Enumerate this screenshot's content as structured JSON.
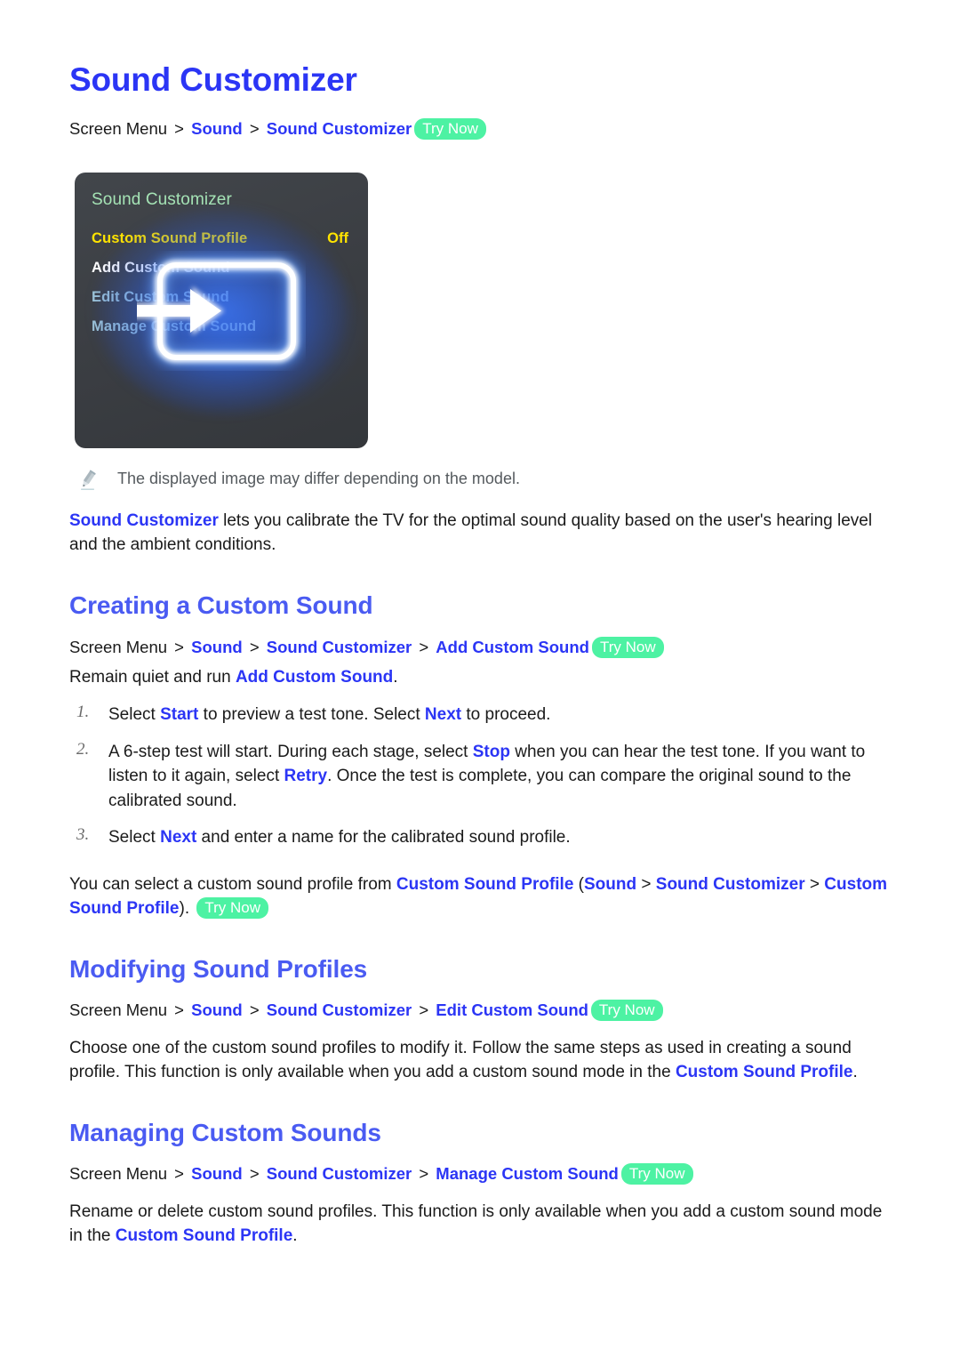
{
  "document": {
    "title": "Sound Customizer"
  },
  "intro": {
    "breadcrumb": {
      "root": "Screen Menu",
      "sep": ">",
      "parts": [
        "Sound",
        "Sound Customizer"
      ],
      "try_now": "Try Now"
    },
    "note_icon": "pencil-icon",
    "note": "The displayed image may differ depending on the model.",
    "paragraph": {
      "link": "Sound Customizer",
      "rest": " lets you calibrate the TV for the optimal sound quality based on the user's hearing level and the ambient conditions."
    }
  },
  "tv_mock": {
    "title": "Sound Customizer",
    "rows": [
      {
        "label": "Custom Sound Profile",
        "value": "Off",
        "state": "highlighted"
      },
      {
        "label": "Add Custom Sound",
        "value": "",
        "state": "active"
      },
      {
        "label": "Edit Custom Sound",
        "value": "",
        "state": "dimmed"
      },
      {
        "label": "Manage Custom Sound",
        "value": "",
        "state": "dimmed"
      }
    ],
    "overlay_icon": "tv-arrow-glow-icon",
    "colors": {
      "panel_bg": "#3b3e43",
      "title": "#a5e3b5",
      "highlight": "#ffe400",
      "active": "#ffffff",
      "dimmed": "#9fc6d8",
      "glow": "#3c78ff"
    }
  },
  "sections": [
    {
      "heading": "Creating a Custom Sound",
      "breadcrumb": {
        "root": "Screen Menu",
        "sep": ">",
        "parts": [
          "Sound",
          "Sound Customizer",
          "Add Custom Sound"
        ],
        "try_now": "Try Now"
      },
      "lead_pre": "Remain quiet and run ",
      "lead_link": "Add Custom Sound",
      "lead_post": ".",
      "steps": [
        {
          "num": "1.",
          "segments": [
            {
              "t": "Select ",
              "s": "plain"
            },
            {
              "t": "Start",
              "s": "blue"
            },
            {
              "t": " to preview a test tone. Select ",
              "s": "plain"
            },
            {
              "t": "Next",
              "s": "blue"
            },
            {
              "t": " to proceed.",
              "s": "plain"
            }
          ]
        },
        {
          "num": "2.",
          "segments": [
            {
              "t": "A 6-step test will start. During each stage, select ",
              "s": "plain"
            },
            {
              "t": "Stop",
              "s": "blue"
            },
            {
              "t": " when you can hear the test tone. If you want to listen to it again, select ",
              "s": "plain"
            },
            {
              "t": "Retry",
              "s": "blue"
            },
            {
              "t": ". Once the test is complete, you can compare the original sound to the calibrated sound.",
              "s": "plain"
            }
          ]
        },
        {
          "num": "3.",
          "segments": [
            {
              "t": "Select ",
              "s": "plain"
            },
            {
              "t": "Next",
              "s": "blue"
            },
            {
              "t": " and enter a name for the calibrated sound profile.",
              "s": "plain"
            }
          ]
        }
      ],
      "outro": [
        {
          "t": "You can select a custom sound profile from ",
          "s": "plain"
        },
        {
          "t": "Custom Sound Profile",
          "s": "blue-b"
        },
        {
          "t": " (",
          "s": "plain"
        },
        {
          "t": "Sound",
          "s": "blue-b"
        },
        {
          "t": " ",
          "s": "plain"
        },
        {
          "t": ">",
          "s": "plain"
        },
        {
          "t": " ",
          "s": "plain"
        },
        {
          "t": "Sound Customizer",
          "s": "blue-b"
        },
        {
          "t": " ",
          "s": "plain"
        },
        {
          "t": ">",
          "s": "plain"
        },
        {
          "t": " ",
          "s": "plain"
        },
        {
          "t": "Custom Sound Profile",
          "s": "blue-b"
        },
        {
          "t": "). ",
          "s": "plain"
        },
        {
          "t": "Try Now",
          "s": "trynow"
        }
      ]
    },
    {
      "heading": "Modifying Sound Profiles",
      "breadcrumb": {
        "root": "Screen Menu",
        "sep": ">",
        "parts": [
          "Sound",
          "Sound Customizer",
          "Edit Custom Sound"
        ],
        "try_now": "Try Now"
      },
      "body": [
        {
          "t": "Choose one of the custom sound profiles to modify it. Follow the same steps as used in creating a sound profile. This function is only available when you add a custom sound mode in the ",
          "s": "plain"
        },
        {
          "t": "Custom Sound Profile",
          "s": "blue-b"
        },
        {
          "t": ".",
          "s": "plain"
        }
      ]
    },
    {
      "heading": "Managing Custom Sounds",
      "breadcrumb": {
        "root": "Screen Menu",
        "sep": ">",
        "parts": [
          "Sound",
          "Sound Customizer",
          "Manage Custom Sound"
        ],
        "try_now": "Try Now"
      },
      "body": [
        {
          "t": "Rename or delete custom sound profiles. This function is only available when you add a custom sound mode in the ",
          "s": "plain"
        },
        {
          "t": "Custom Sound Profile",
          "s": "blue-b"
        },
        {
          "t": ".",
          "s": "plain"
        }
      ]
    }
  ]
}
